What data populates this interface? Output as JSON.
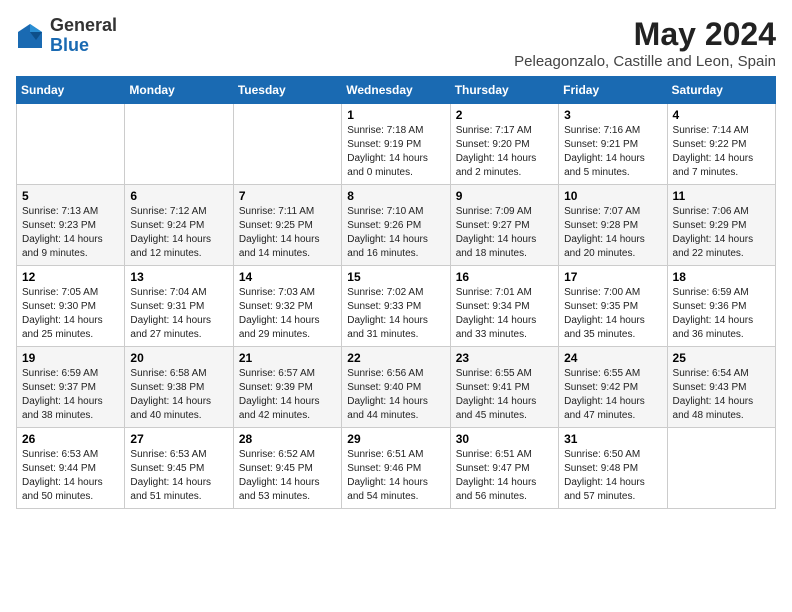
{
  "header": {
    "logo_general": "General",
    "logo_blue": "Blue",
    "month_title": "May 2024",
    "location": "Peleagonzalo, Castille and Leon, Spain"
  },
  "calendar": {
    "weekdays": [
      "Sunday",
      "Monday",
      "Tuesday",
      "Wednesday",
      "Thursday",
      "Friday",
      "Saturday"
    ],
    "weeks": [
      [
        {
          "day": "",
          "info": ""
        },
        {
          "day": "",
          "info": ""
        },
        {
          "day": "",
          "info": ""
        },
        {
          "day": "1",
          "info": "Sunrise: 7:18 AM\nSunset: 9:19 PM\nDaylight: 14 hours\nand 0 minutes."
        },
        {
          "day": "2",
          "info": "Sunrise: 7:17 AM\nSunset: 9:20 PM\nDaylight: 14 hours\nand 2 minutes."
        },
        {
          "day": "3",
          "info": "Sunrise: 7:16 AM\nSunset: 9:21 PM\nDaylight: 14 hours\nand 5 minutes."
        },
        {
          "day": "4",
          "info": "Sunrise: 7:14 AM\nSunset: 9:22 PM\nDaylight: 14 hours\nand 7 minutes."
        }
      ],
      [
        {
          "day": "5",
          "info": "Sunrise: 7:13 AM\nSunset: 9:23 PM\nDaylight: 14 hours\nand 9 minutes."
        },
        {
          "day": "6",
          "info": "Sunrise: 7:12 AM\nSunset: 9:24 PM\nDaylight: 14 hours\nand 12 minutes."
        },
        {
          "day": "7",
          "info": "Sunrise: 7:11 AM\nSunset: 9:25 PM\nDaylight: 14 hours\nand 14 minutes."
        },
        {
          "day": "8",
          "info": "Sunrise: 7:10 AM\nSunset: 9:26 PM\nDaylight: 14 hours\nand 16 minutes."
        },
        {
          "day": "9",
          "info": "Sunrise: 7:09 AM\nSunset: 9:27 PM\nDaylight: 14 hours\nand 18 minutes."
        },
        {
          "day": "10",
          "info": "Sunrise: 7:07 AM\nSunset: 9:28 PM\nDaylight: 14 hours\nand 20 minutes."
        },
        {
          "day": "11",
          "info": "Sunrise: 7:06 AM\nSunset: 9:29 PM\nDaylight: 14 hours\nand 22 minutes."
        }
      ],
      [
        {
          "day": "12",
          "info": "Sunrise: 7:05 AM\nSunset: 9:30 PM\nDaylight: 14 hours\nand 25 minutes."
        },
        {
          "day": "13",
          "info": "Sunrise: 7:04 AM\nSunset: 9:31 PM\nDaylight: 14 hours\nand 27 minutes."
        },
        {
          "day": "14",
          "info": "Sunrise: 7:03 AM\nSunset: 9:32 PM\nDaylight: 14 hours\nand 29 minutes."
        },
        {
          "day": "15",
          "info": "Sunrise: 7:02 AM\nSunset: 9:33 PM\nDaylight: 14 hours\nand 31 minutes."
        },
        {
          "day": "16",
          "info": "Sunrise: 7:01 AM\nSunset: 9:34 PM\nDaylight: 14 hours\nand 33 minutes."
        },
        {
          "day": "17",
          "info": "Sunrise: 7:00 AM\nSunset: 9:35 PM\nDaylight: 14 hours\nand 35 minutes."
        },
        {
          "day": "18",
          "info": "Sunrise: 6:59 AM\nSunset: 9:36 PM\nDaylight: 14 hours\nand 36 minutes."
        }
      ],
      [
        {
          "day": "19",
          "info": "Sunrise: 6:59 AM\nSunset: 9:37 PM\nDaylight: 14 hours\nand 38 minutes."
        },
        {
          "day": "20",
          "info": "Sunrise: 6:58 AM\nSunset: 9:38 PM\nDaylight: 14 hours\nand 40 minutes."
        },
        {
          "day": "21",
          "info": "Sunrise: 6:57 AM\nSunset: 9:39 PM\nDaylight: 14 hours\nand 42 minutes."
        },
        {
          "day": "22",
          "info": "Sunrise: 6:56 AM\nSunset: 9:40 PM\nDaylight: 14 hours\nand 44 minutes."
        },
        {
          "day": "23",
          "info": "Sunrise: 6:55 AM\nSunset: 9:41 PM\nDaylight: 14 hours\nand 45 minutes."
        },
        {
          "day": "24",
          "info": "Sunrise: 6:55 AM\nSunset: 9:42 PM\nDaylight: 14 hours\nand 47 minutes."
        },
        {
          "day": "25",
          "info": "Sunrise: 6:54 AM\nSunset: 9:43 PM\nDaylight: 14 hours\nand 48 minutes."
        }
      ],
      [
        {
          "day": "26",
          "info": "Sunrise: 6:53 AM\nSunset: 9:44 PM\nDaylight: 14 hours\nand 50 minutes."
        },
        {
          "day": "27",
          "info": "Sunrise: 6:53 AM\nSunset: 9:45 PM\nDaylight: 14 hours\nand 51 minutes."
        },
        {
          "day": "28",
          "info": "Sunrise: 6:52 AM\nSunset: 9:45 PM\nDaylight: 14 hours\nand 53 minutes."
        },
        {
          "day": "29",
          "info": "Sunrise: 6:51 AM\nSunset: 9:46 PM\nDaylight: 14 hours\nand 54 minutes."
        },
        {
          "day": "30",
          "info": "Sunrise: 6:51 AM\nSunset: 9:47 PM\nDaylight: 14 hours\nand 56 minutes."
        },
        {
          "day": "31",
          "info": "Sunrise: 6:50 AM\nSunset: 9:48 PM\nDaylight: 14 hours\nand 57 minutes."
        },
        {
          "day": "",
          "info": ""
        }
      ]
    ]
  }
}
